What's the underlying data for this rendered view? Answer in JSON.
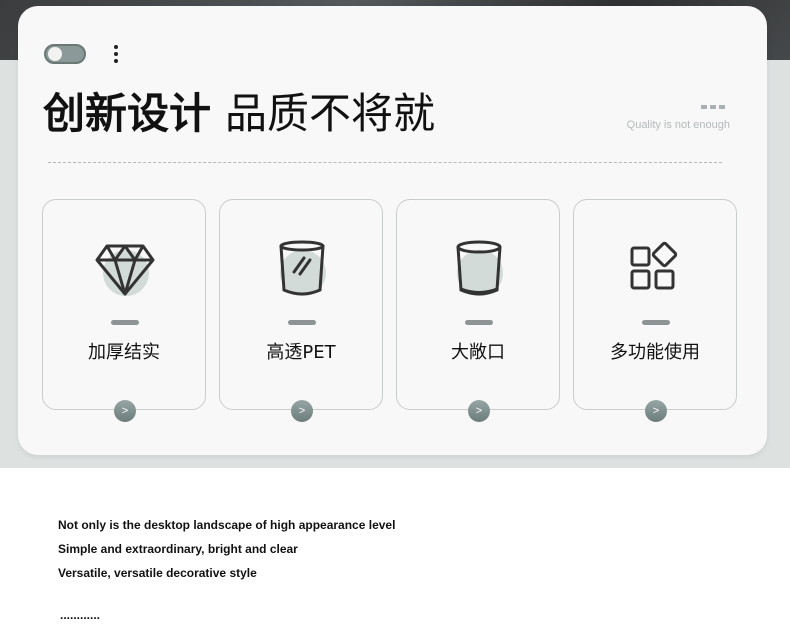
{
  "header": {
    "title_bold": "创新设计",
    "title_light": "品质不将就",
    "subtitle": "Quality is not enough"
  },
  "features": [
    {
      "label": "加厚结实",
      "icon": "diamond-icon",
      "go": ">"
    },
    {
      "label": "高透PET",
      "icon": "clear-cup-icon",
      "go": ">"
    },
    {
      "label": "大敞口",
      "icon": "wide-mouth-cup-icon",
      "go": ">"
    },
    {
      "label": "多功能使用",
      "icon": "multi-grid-icon",
      "go": ">"
    }
  ],
  "description": {
    "lines": [
      "Not only is the desktop landscape of high appearance level",
      "Simple and extraordinary, bright and clear",
      "Versatile, versatile decorative style"
    ],
    "ellipsis": "............"
  },
  "colors": {
    "accent": "#7e8f8d",
    "band": "#dde2e1",
    "card": "#f8f8f8"
  }
}
